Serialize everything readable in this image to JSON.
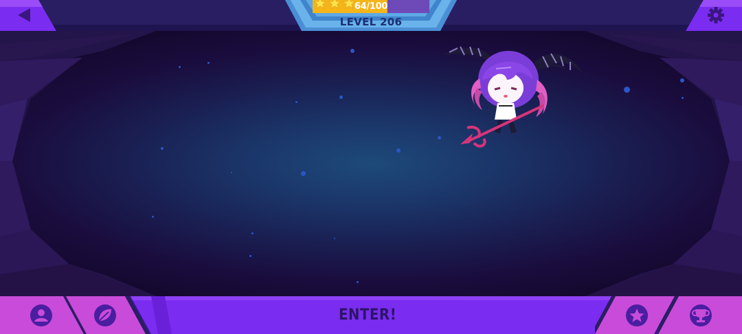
{
  "hud": {
    "stars": 3,
    "progress_text": "64/100",
    "progress_fraction": 0.64,
    "level_text": "LEVEL 206"
  },
  "top_left_button": {
    "icon": "back-arrow-icon"
  },
  "top_right_button": {
    "icon": "gear-icon"
  },
  "bottom_bar": {
    "enter_label": "ENTER!",
    "left_buttons": [
      {
        "icon": "profile-icon"
      },
      {
        "icon": "leaf-icon"
      }
    ],
    "right_buttons": [
      {
        "icon": "star-icon"
      },
      {
        "icon": "trophy-icon"
      }
    ]
  },
  "character": {
    "icon": "winged-devil-girl-with-trident"
  },
  "colors": {
    "accent_purple": "#7a2cf0",
    "button_pink": "#c94bd9",
    "bar_dark": "#2a1e62",
    "space_blue": "#1d4a7a",
    "star_gold": "#f5c518",
    "enter_text": "#2d1466"
  }
}
